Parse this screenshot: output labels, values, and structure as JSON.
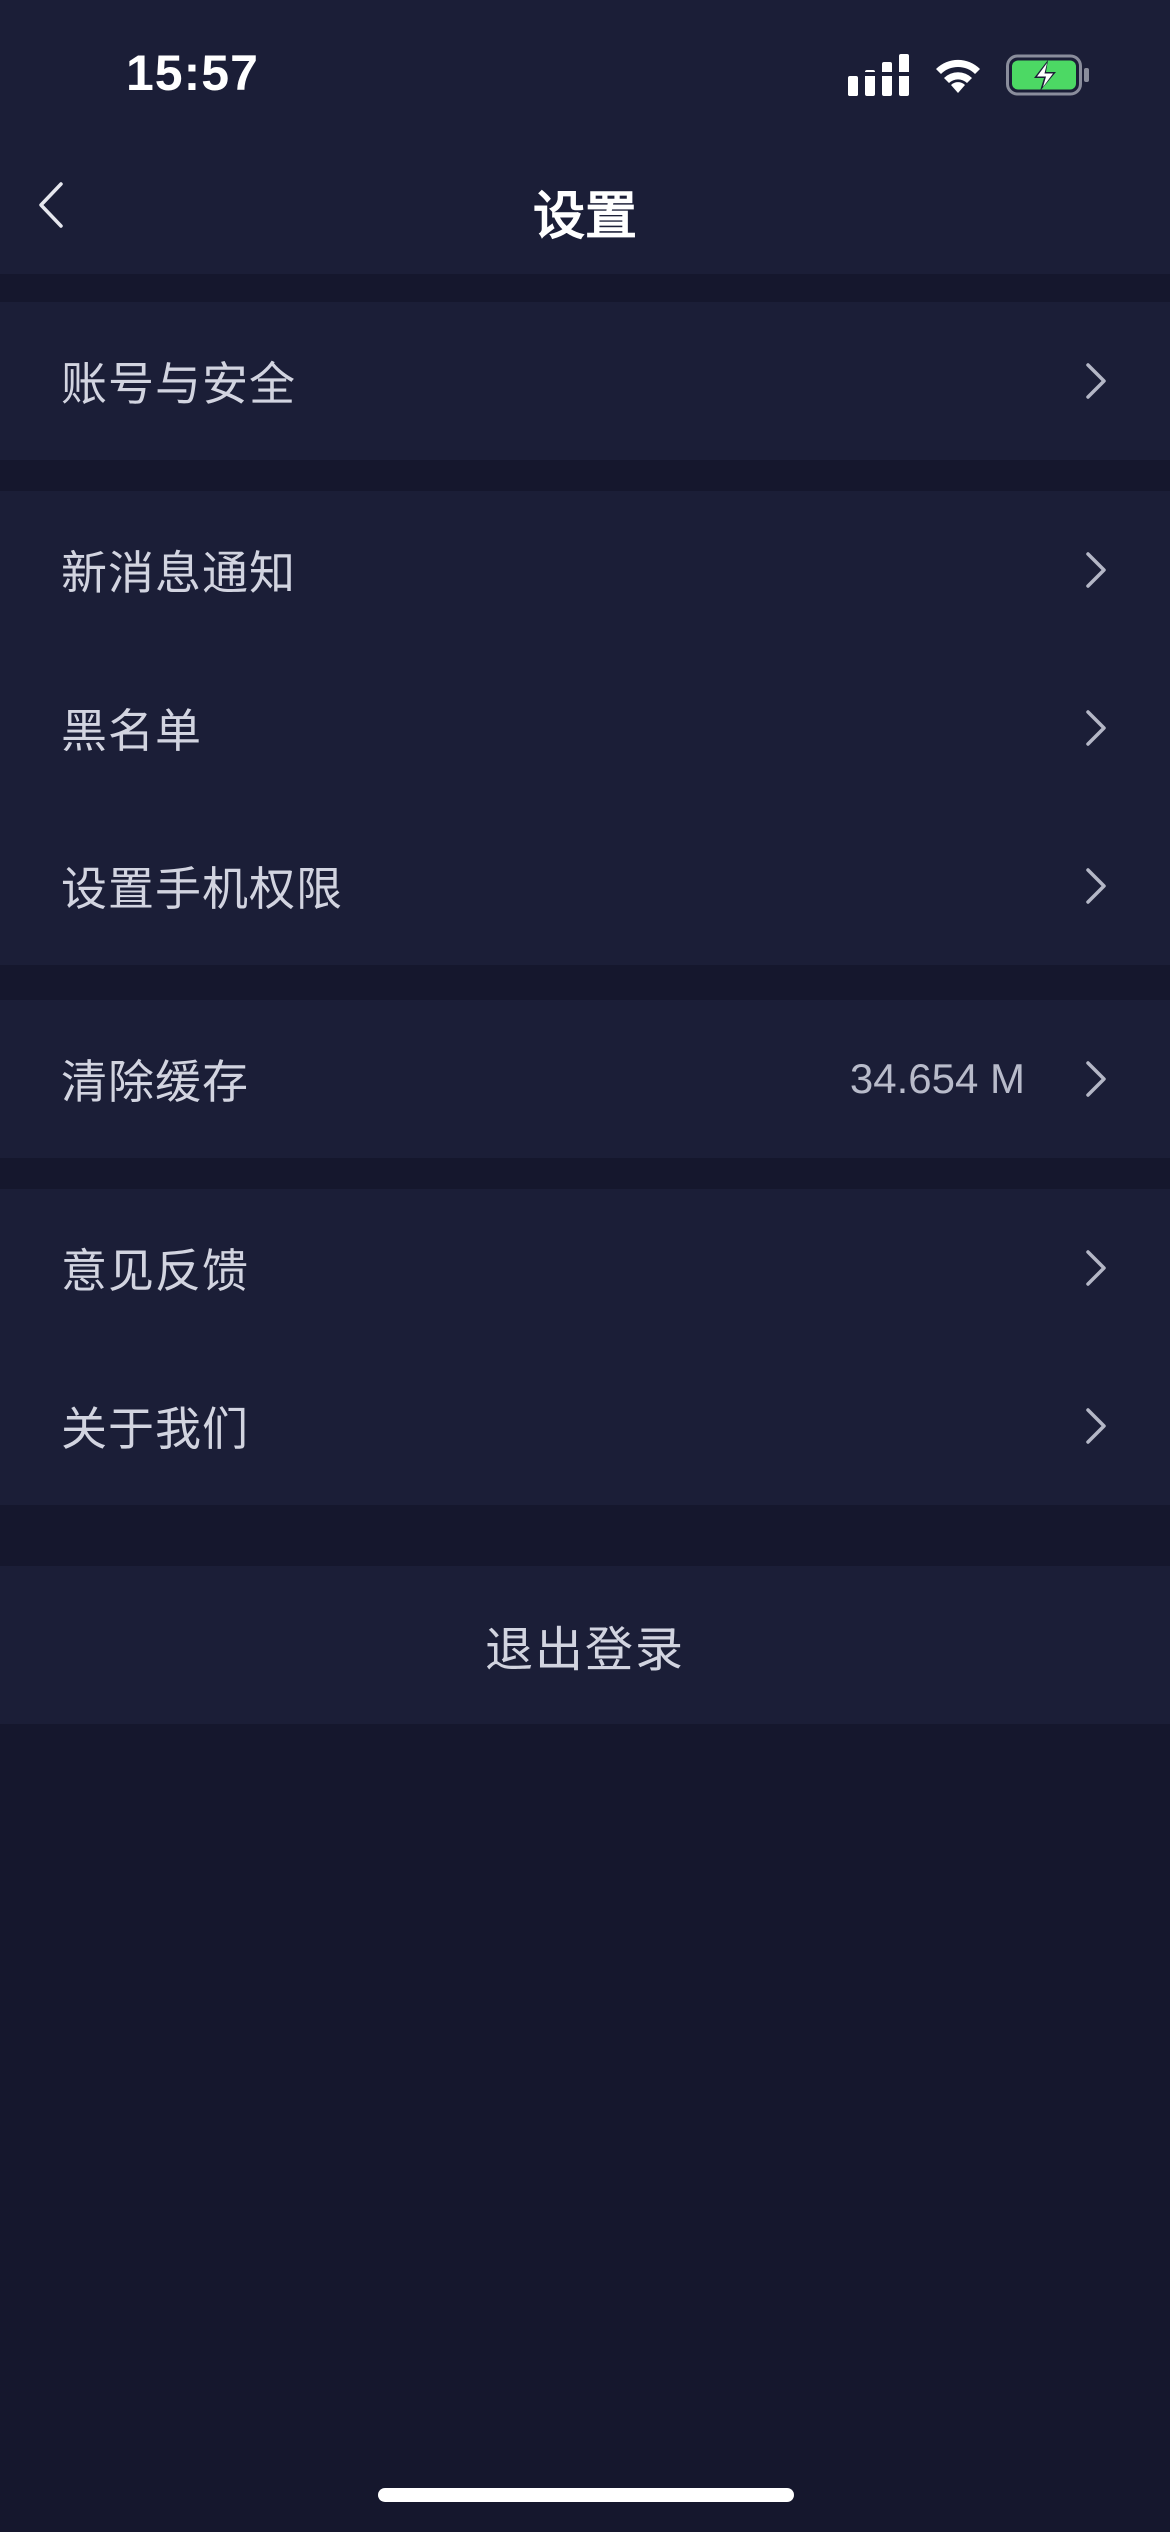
{
  "status_bar": {
    "time": "15:57",
    "icons": [
      "cellular-signal-icon",
      "wifi-icon",
      "battery-charging-icon"
    ],
    "battery_color": "#4cd964"
  },
  "nav": {
    "back_icon": "chevron-left-icon",
    "title": "设置"
  },
  "groups": [
    {
      "items": [
        {
          "label": "账号与安全"
        }
      ]
    },
    {
      "items": [
        {
          "label": "新消息通知"
        },
        {
          "label": "黑名单"
        },
        {
          "label": "设置手机权限"
        }
      ]
    },
    {
      "items": [
        {
          "label": "清除缓存",
          "value": "34.654 M"
        }
      ]
    },
    {
      "items": [
        {
          "label": "意见反馈"
        },
        {
          "label": "关于我们"
        }
      ]
    }
  ],
  "logout": {
    "label": "退出登录"
  },
  "colors": {
    "background": "#15172d",
    "panel": "#1b1e37",
    "text": "#d2d4e0",
    "title": "#ffffff"
  }
}
